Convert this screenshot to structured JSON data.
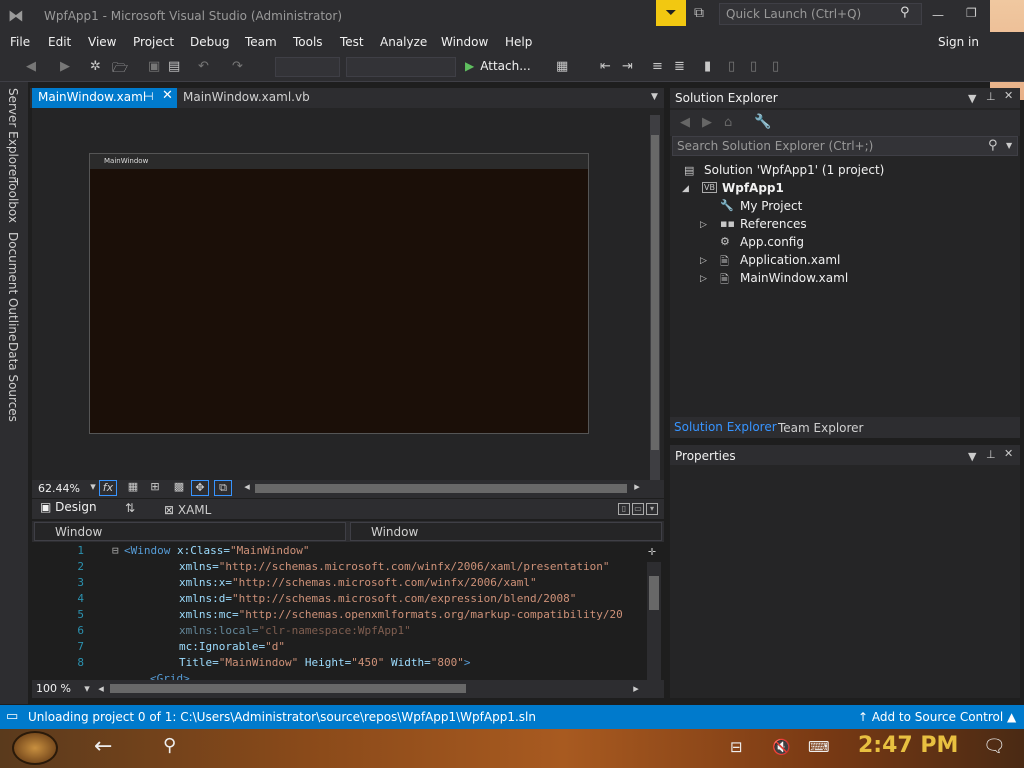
{
  "window": {
    "title": "WpfApp1 - Microsoft Visual Studio  (Administrator)",
    "quick_launch_placeholder": "Quick Launch (Ctrl+Q)",
    "sign_in": "Sign in"
  },
  "menu": [
    "File",
    "Edit",
    "View",
    "Project",
    "Debug",
    "Team",
    "Tools",
    "Test",
    "Analyze",
    "Window",
    "Help"
  ],
  "toolbar": {
    "attach_label": "Attach..."
  },
  "left_rail": [
    "Server Explorer",
    "Toolbox",
    "Document Outline",
    "Data Sources"
  ],
  "doc_tabs": [
    {
      "label": "MainWindow.xaml",
      "active": true
    },
    {
      "label": "MainWindow.xaml.vb",
      "active": false
    }
  ],
  "designer": {
    "window_title": "MainWindow",
    "zoom": "62.44%",
    "fx_label": "fx"
  },
  "split": {
    "design_label": "Design",
    "xaml_label": "XAML"
  },
  "nav": {
    "left": "Window",
    "right": "Window"
  },
  "editor": {
    "line_numbers": [
      "1",
      "2",
      "3",
      "4",
      "5",
      "6",
      "7",
      "8"
    ],
    "zoom": "100 %",
    "lines": [
      {
        "p": "<",
        "t": "Window",
        "a": " x:Class=",
        "v": "\"MainWindow\""
      },
      {
        "a": "xmlns=",
        "v": "\"http://schemas.microsoft.com/winfx/2006/xaml/presentation\""
      },
      {
        "a": "xmlns:x=",
        "v": "\"http://schemas.microsoft.com/winfx/2006/xaml\""
      },
      {
        "a": "xmlns:d=",
        "v": "\"http://schemas.microsoft.com/expression/blend/2008\""
      },
      {
        "a": "xmlns:mc=",
        "v": "\"http://schemas.openxmlformats.org/markup-compatibility/20"
      },
      {
        "a": "xmlns:local=",
        "v": "\"clr-namespace:WpfApp1\""
      },
      {
        "a": "mc:Ignorable=",
        "v": "\"d\""
      },
      {
        "a": "Title=",
        "v": "\"MainWindow\"",
        "a2": " Height=",
        "v2": "\"450\"",
        "a3": " Width=",
        "v3": "\"800\"",
        "e": ">"
      }
    ],
    "partial_line": "<Grid>"
  },
  "solution_explorer": {
    "title": "Solution Explorer",
    "search_placeholder": "Search Solution Explorer (Ctrl+;)",
    "items": [
      {
        "label": "Solution 'WpfApp1' (1 project)",
        "icon": "solution-icon"
      },
      {
        "label": "WpfApp1",
        "icon": "vb-project-icon"
      },
      {
        "label": "My Project",
        "icon": "wrench-icon"
      },
      {
        "label": "References",
        "icon": "references-icon"
      },
      {
        "label": "App.config",
        "icon": "config-file-icon"
      },
      {
        "label": "Application.xaml",
        "icon": "xaml-file-icon"
      },
      {
        "label": "MainWindow.xaml",
        "icon": "xaml-file-icon"
      }
    ],
    "tabs": [
      "Solution Explorer",
      "Team Explorer"
    ]
  },
  "properties": {
    "title": "Properties"
  },
  "status": {
    "text": "Unloading project 0 of 1: C:\\Users\\Administrator\\source\\repos\\WpfApp1\\WpfApp1.sln",
    "source_control": "Add to Source Control"
  },
  "taskbar": {
    "time": "2:47 PM"
  },
  "colors": {
    "accent": "#007acc",
    "background": "#1e1e1e",
    "chrome": "#2d2d30",
    "filter_badge": "#f2c811"
  }
}
